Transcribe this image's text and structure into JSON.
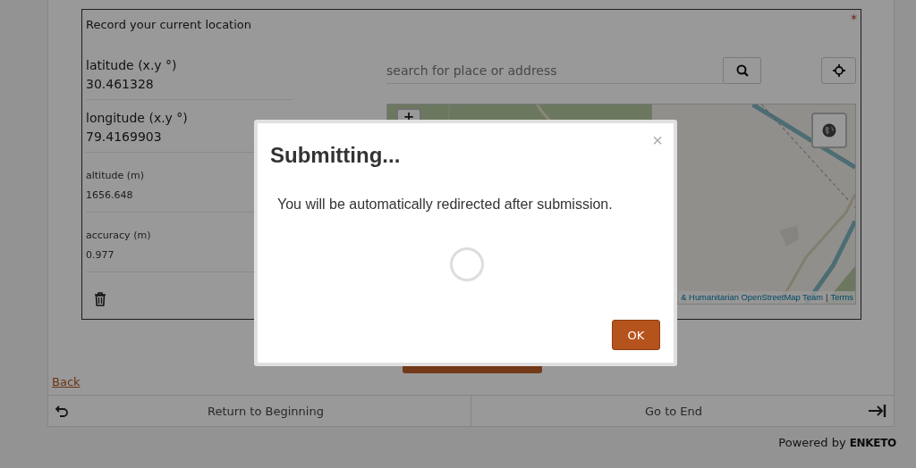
{
  "form": {
    "question": {
      "label": "Record your current location",
      "required_mark": "*",
      "fields": [
        {
          "kind": "large",
          "label": "latitude (x.y °)",
          "value": "30.461328"
        },
        {
          "kind": "large",
          "label": "longitude (x.y °)",
          "value": "79.4169903"
        },
        {
          "kind": "small",
          "label": "altitude (m)",
          "value": "1656.648"
        },
        {
          "kind": "small",
          "label": "accuracy (m)",
          "value": "0.977"
        }
      ],
      "search": {
        "placeholder": "search for place or address"
      },
      "map": {
        "zoom_in": "+",
        "attribution": "& Humanitarian OpenStreetMap Team",
        "separator": "|",
        "terms": "Terms"
      }
    },
    "back_link": "Back",
    "nav": [
      {
        "kind": "start",
        "label": "Return to Beginning"
      },
      {
        "kind": "end",
        "label": "Go to End"
      }
    ]
  },
  "footer": {
    "powered_by": "Powered by",
    "brand": "ENKETO"
  },
  "modal": {
    "title": "Submitting...",
    "close": "×",
    "message": "You will be automatically redirected after submission.",
    "ok": "OK"
  }
}
